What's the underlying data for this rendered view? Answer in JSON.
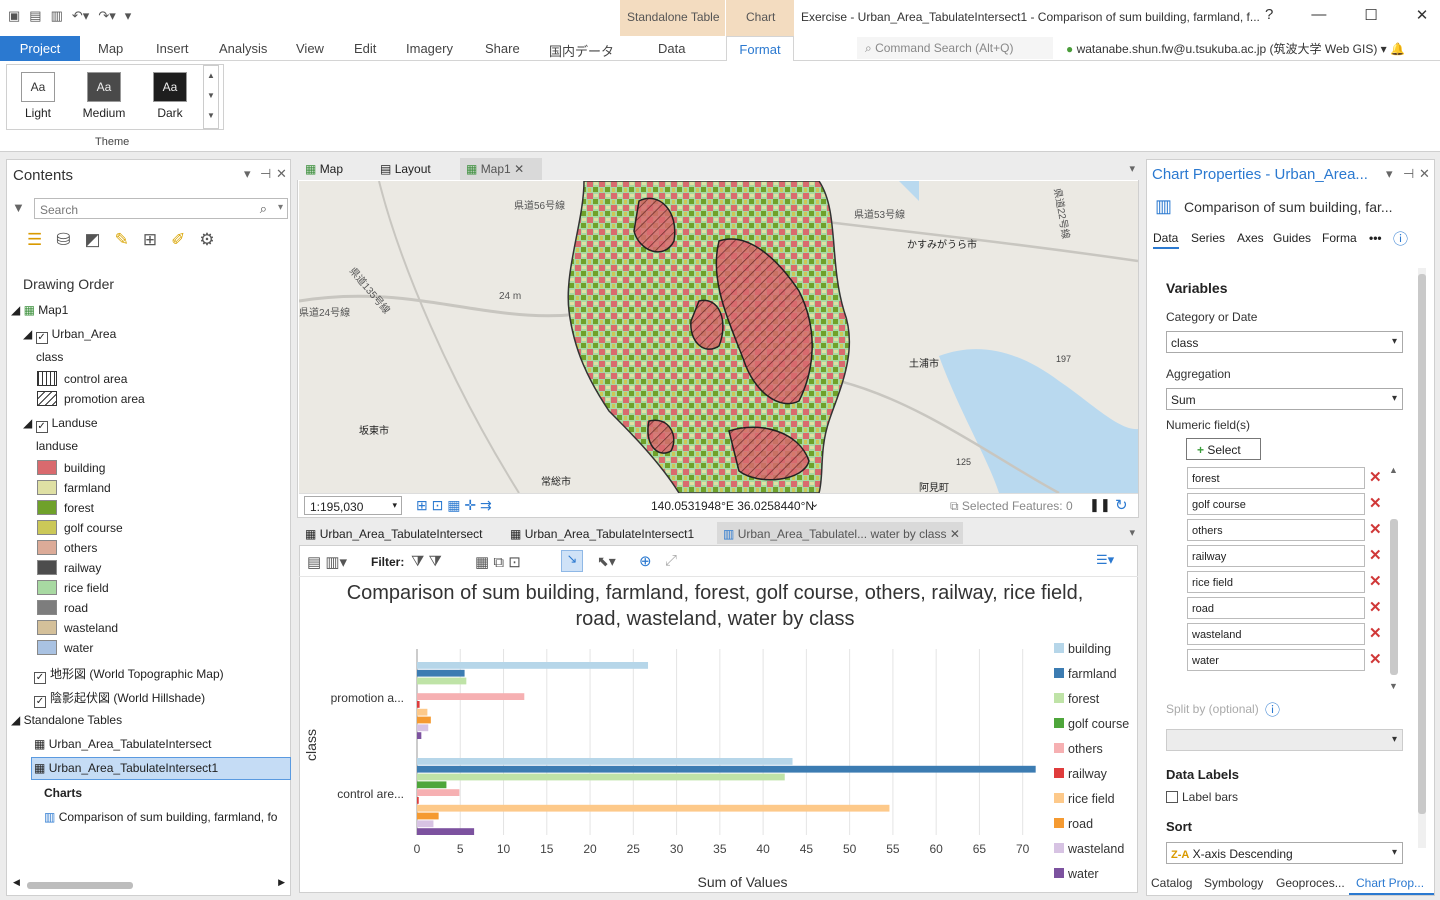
{
  "ribbon": {
    "context_groups": [
      "Standalone Table",
      "Chart"
    ],
    "context_tabs": [
      "Data",
      "Format"
    ],
    "tabs": [
      "Project",
      "Map",
      "Insert",
      "Analysis",
      "View",
      "Edit",
      "Imagery",
      "Share",
      "国内データ"
    ],
    "window_title": "Exercise - Urban_Area_TabulateIntersect1 - Comparison of sum building, farmland, f...",
    "command_search_placeholder": "Command Search (Alt+Q)",
    "user": "watanabe.shun.fw@u.tsukuba.ac.jp (筑波大学 Web GIS) ▾",
    "help": "?",
    "theme_buttons": [
      "Light",
      "Medium",
      "Dark"
    ],
    "theme_glyph": "Aa",
    "group_label": "Theme"
  },
  "contents": {
    "title": "Contents",
    "search_placeholder": "Search",
    "drawing_order": "Drawing Order",
    "map_name": "Map1",
    "urban_layer": "Urban_Area",
    "urban_field": "class",
    "urban_classes": [
      "control area",
      "promotion area"
    ],
    "landuse_layer": "Landuse",
    "landuse_field": "landuse",
    "landuse_classes": [
      {
        "label": "building",
        "color": "#d96a6e"
      },
      {
        "label": "farmland",
        "color": "#dfe0a4"
      },
      {
        "label": "forest",
        "color": "#6fa12a"
      },
      {
        "label": "golf course",
        "color": "#cbc858"
      },
      {
        "label": "others",
        "color": "#dcab98"
      },
      {
        "label": "railway",
        "color": "#4d4d4d"
      },
      {
        "label": "rice field",
        "color": "#a8d9a2"
      },
      {
        "label": "road",
        "color": "#7d7d7d"
      },
      {
        "label": "wasteland",
        "color": "#d4c09a"
      },
      {
        "label": "water",
        "color": "#a9c2e2"
      }
    ],
    "basemaps": [
      "地形図 (World Topographic Map)",
      "陰影起伏図 (World Hillshade)"
    ],
    "standalone_header": "Standalone Tables",
    "tables": [
      "Urban_Area_TabulateIntersect",
      "Urban_Area_TabulateIntersect1"
    ],
    "charts_header": "Charts",
    "chart_item": "Comparison of sum building, farmland, fo"
  },
  "map": {
    "view_tabs": [
      "Map",
      "Layout",
      "Map1"
    ],
    "labels": [
      "県道56号線",
      "県道53号線",
      "かすみがうら市",
      "県道135号線",
      "24 m",
      "県道24号線",
      "土浦市",
      "197",
      "坂東市",
      "125",
      "常総市",
      "阿見町",
      "県道22号線"
    ],
    "scale": "1:195,030",
    "coords": "140.0531948°E 36.0258440°N",
    "selected": "Selected Features: 0"
  },
  "chart_panel": {
    "tabs": [
      "Urban_Area_TabulateIntersect",
      "Urban_Area_TabulateIntersect1",
      "Urban_Area_Tabulatel... water by class"
    ],
    "filter_label": "Filter:"
  },
  "chart_data": {
    "type": "bar",
    "orientation": "horizontal",
    "title": "Comparison of sum building, farmland, forest, golf course, others, railway, rice field, road, wasteland, water by class",
    "xlabel": "Sum of Values",
    "ylabel": "class",
    "xlim": [
      0,
      72
    ],
    "xticks": [
      0,
      5,
      10,
      15,
      20,
      25,
      30,
      35,
      40,
      45,
      50,
      55,
      60,
      65,
      70
    ],
    "categories": [
      "promotion a...",
      "control are..."
    ],
    "legend_position": "right",
    "series": [
      {
        "name": "building",
        "color": "#b6d6e9",
        "values": [
          26.7,
          43.4
        ]
      },
      {
        "name": "farmland",
        "color": "#3c7cb2",
        "values": [
          5.5,
          71.5
        ]
      },
      {
        "name": "forest",
        "color": "#bfe3a7",
        "values": [
          5.7,
          42.5
        ]
      },
      {
        "name": "golf course",
        "color": "#4ea63b",
        "values": [
          0,
          3.4
        ]
      },
      {
        "name": "others",
        "color": "#f6b0b2",
        "values": [
          12.4,
          4.9
        ]
      },
      {
        "name": "railway",
        "color": "#e03c3c",
        "values": [
          0.3,
          0.2
        ]
      },
      {
        "name": "rice field",
        "color": "#fdc98a",
        "values": [
          1.2,
          54.6
        ]
      },
      {
        "name": "road",
        "color": "#f59a31",
        "values": [
          1.6,
          2.5
        ]
      },
      {
        "name": "wasteland",
        "color": "#d7c3e3",
        "values": [
          1.3,
          1.9
        ]
      },
      {
        "name": "water",
        "color": "#7c529f",
        "values": [
          0.5,
          6.6
        ]
      }
    ]
  },
  "properties": {
    "title": "Chart Properties - Urban_Area...",
    "chart_name": "Comparison of sum building, far...",
    "tabs": [
      "Data",
      "Series",
      "Axes",
      "Guides",
      "Forma"
    ],
    "more": "•••",
    "variables": "Variables",
    "category_label": "Category or Date",
    "category_value": "class",
    "aggregation_label": "Aggregation",
    "aggregation_value": "Sum",
    "numeric_label": "Numeric field(s)",
    "select_button": "Select",
    "fields": [
      "forest",
      "golf course",
      "others",
      "railway",
      "rice field",
      "road",
      "wasteland",
      "water"
    ],
    "split_label": "Split by (optional)",
    "data_labels": "Data Labels",
    "label_bars": "Label bars",
    "sort": "Sort",
    "sort_value": "X-axis Descending",
    "sort_glyph": "Z-A"
  },
  "bottom_tabs": [
    "Catalog",
    "Symbology",
    "Geoproces...",
    "Chart Prop..."
  ]
}
